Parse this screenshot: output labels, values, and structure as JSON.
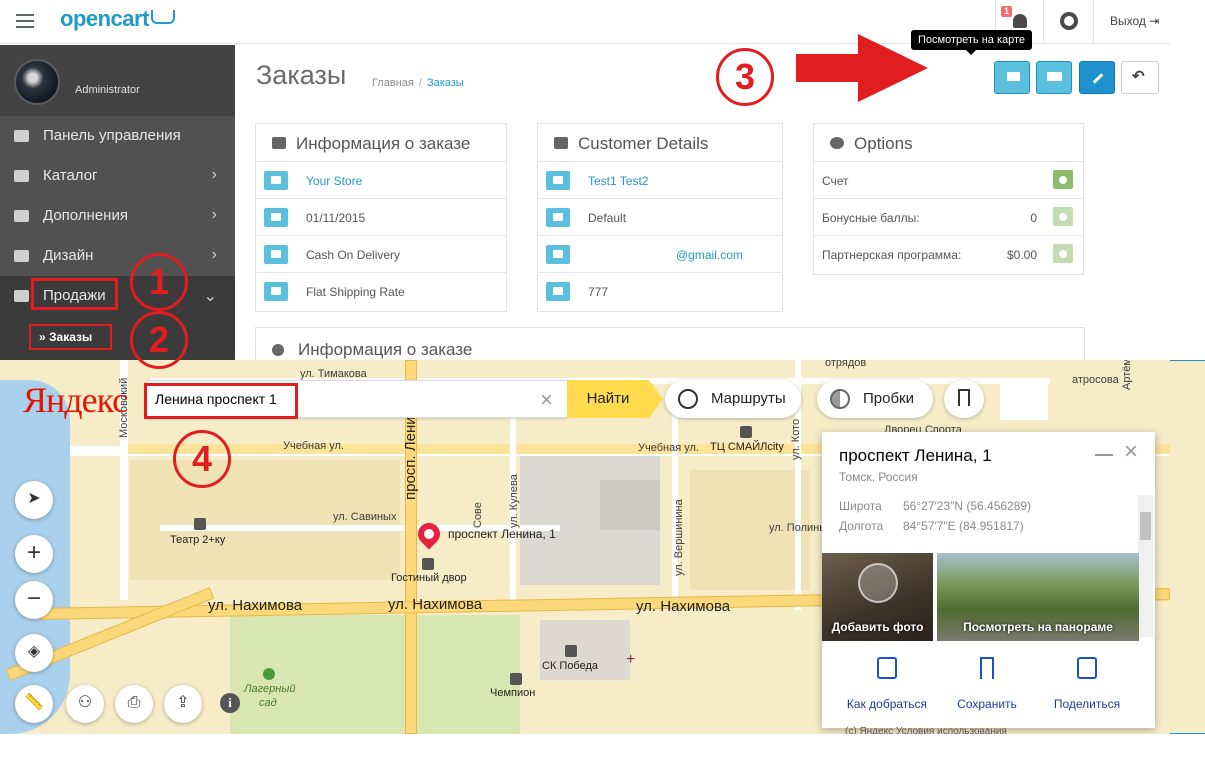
{
  "opencart": {
    "logo": "opencart",
    "notifications_count": "1",
    "logout_label": "Выход",
    "admin_name": "Administrator",
    "menu": [
      {
        "label": "Панель управления"
      },
      {
        "label": "Каталог",
        "chevron": "›"
      },
      {
        "label": "Дополнения",
        "chevron": "›"
      },
      {
        "label": "Дизайн",
        "chevron": "›"
      },
      {
        "label": "Продажи",
        "chevron": "⌄"
      }
    ],
    "submenu_item": "» Заказы",
    "page_title": "Заказы",
    "breadcrumb": {
      "home": "Главная",
      "separator": "/",
      "current": "Заказы"
    },
    "tooltip": "Посмотреть на карте",
    "toolbar_icons": [
      "map-marker-icon",
      "print-icon",
      "truck-icon",
      "pencil-icon",
      "reply-icon"
    ],
    "panels": {
      "order": {
        "title": "Информация о заказе",
        "rows": [
          {
            "text": "Your Store",
            "icon": "cart-icon"
          },
          {
            "text": "01/11/2015",
            "icon": "calendar-icon"
          },
          {
            "text": "Cash On Delivery",
            "icon": "credit-card-icon"
          },
          {
            "text": "Flat Shipping Rate",
            "icon": "truck-icon"
          }
        ]
      },
      "customer": {
        "title": "Customer Details",
        "rows": [
          {
            "text": "Test1 Test2",
            "icon": "user-icon"
          },
          {
            "text": "Default",
            "icon": "group-icon"
          },
          {
            "text": "@gmail.com",
            "icon": "envelope-icon"
          },
          {
            "text": "777",
            "icon": "phone-icon"
          }
        ]
      },
      "options": {
        "title": "Options",
        "rows": [
          {
            "label": "Счет",
            "value": ""
          },
          {
            "label": "Бонусные баллы:",
            "value": "0"
          },
          {
            "label": "Партнерская программа:",
            "value": "$0.00"
          }
        ]
      },
      "order2_title": "Информация о заказе"
    },
    "annotations": [
      "1",
      "2",
      "3",
      "4"
    ]
  },
  "yandex": {
    "logo": "Яндекс",
    "search_value": "Ленина проспект 1",
    "find_label": "Найти",
    "routes_label": "Маршруты",
    "traffic_label": "Пробки",
    "streets": {
      "timakova": "ул. Тимакова",
      "uchebnaya_left": "Учебная ул.",
      "uchebnaya_right": "Учебная ул.",
      "savinykh": "ул. Савиных",
      "nakhimova1": "ул. Нахимова",
      "nakhimova2": "ул. Нахимова",
      "nakhimova3": "ул. Нахимова",
      "lenina": "просп. Ленина",
      "moskovsky": "Московский",
      "sovetskaya": "Сове",
      "kuleva": "ул. Кулева",
      "vershinina": "ул. Вершинина",
      "polinyi": "ул. Полины О",
      "kotov": "ул. Кото",
      "otryadov": "отрядов",
      "artem": "Артём",
      "atrosova": "атросова",
      "dvorets": "Дворец Спорта"
    },
    "pois": {
      "pin": "проспект Ленина, 1",
      "gostiny": "Гостиный двор",
      "teatr": "Театр 2+ку",
      "tc": "ТЦ СМАЙЛcity",
      "ck": "СК Победа",
      "chempion": "Чемпион",
      "lagerny": "Лагерный",
      "sad": "сад"
    },
    "card": {
      "title": "проспект Ленина, 1",
      "subtitle": "Томск, Россия",
      "lat_label": "Широта",
      "lat_value": "56°27′23″N (56.456289)",
      "lon_label": "Долгота",
      "lon_value": "84°57′7″E (84.951817)",
      "photo1_label": "Добавить фото",
      "photo2_label": "Посмотреть на панораме",
      "actions": [
        {
          "label": "Как добраться",
          "icon": "route-icon"
        },
        {
          "label": "Сохранить",
          "icon": "bookmark-icon"
        },
        {
          "label": "Поделиться",
          "icon": "share-icon"
        }
      ]
    },
    "copyright": "(с) Яндекс Условия использования"
  },
  "colors": {
    "accent": "#229ac8",
    "sidebar": "#515151",
    "highlight_red": "#e11d20",
    "toolbar_info": "#5bc0de",
    "toolbar_primary": "#1e91cf",
    "yandex_yellow": "#ffdb4d"
  }
}
